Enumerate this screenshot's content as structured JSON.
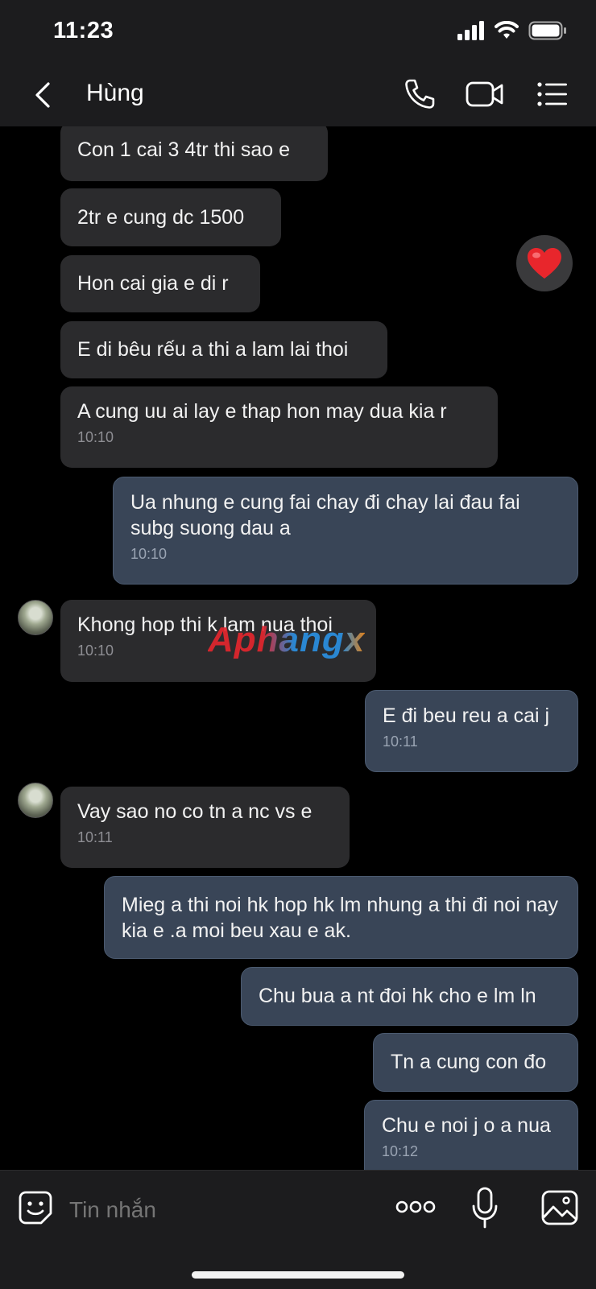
{
  "status": {
    "time": "11:23"
  },
  "header": {
    "contact_name": "Hùng",
    "icons": [
      "back-icon",
      "phone-icon",
      "video-icon",
      "menu-icon"
    ]
  },
  "messages": [
    {
      "side": "received",
      "text": "Con 1 cai 3 4tr thi sao e",
      "time": ""
    },
    {
      "side": "received",
      "text": "2tr e cung dc 1500",
      "time": ""
    },
    {
      "side": "received",
      "text": "Hon cai gia e di r",
      "time": ""
    },
    {
      "side": "received",
      "text": "E di bêu rếu a thi a lam lai thoi",
      "time": ""
    },
    {
      "side": "received",
      "text": "A cung uu ai lay e thap hon may dua kia r",
      "time": "10:10"
    },
    {
      "side": "sent",
      "text": "Ua nhung e cung fai chay đi chay lai đau fai subg suong dau a",
      "time": "10:10"
    },
    {
      "side": "received",
      "text": "Khong hop thi k lam nua thoi",
      "time": "10:10"
    },
    {
      "side": "sent",
      "text": "E đi beu reu a cai j",
      "time": "10:11"
    },
    {
      "side": "received",
      "text": "Vay sao no co tn a nc vs e",
      "time": "10:11"
    },
    {
      "side": "sent",
      "text": "Mieg a thi noi hk hop hk lm nhung a thi đi noi nay kia e .a moi beu xau e ak.",
      "time": ""
    },
    {
      "side": "sent",
      "text": "Chu bua a nt đoi hk cho e lm ln",
      "time": ""
    },
    {
      "side": "sent",
      "text": "Tn a cung con đo",
      "time": ""
    },
    {
      "side": "sent",
      "text": "Chu e noi j o a nua",
      "time": "10:12"
    }
  ],
  "reaction": {
    "emoji": "❤️"
  },
  "watermark": {
    "text": "Aphangx"
  },
  "composer": {
    "placeholder": "Tin nhắn",
    "more_label": "ooo",
    "icons": [
      "sticker-icon",
      "more-icon",
      "microphone-icon",
      "image-icon"
    ]
  },
  "colors": {
    "background": "#000000",
    "bar_background": "#1c1c1e",
    "received_bubble": "#2b2b2d",
    "sent_bubble": "#394557",
    "heart": "#e8262c"
  }
}
